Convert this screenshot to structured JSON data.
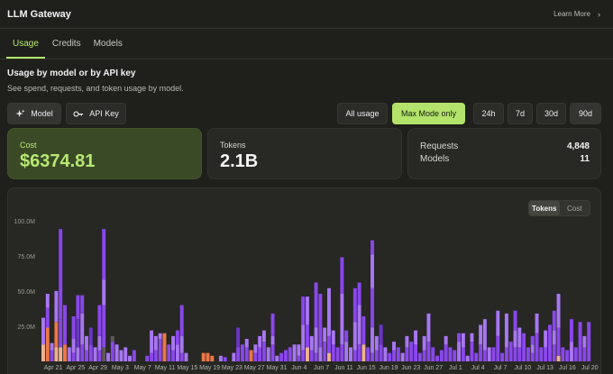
{
  "header": {
    "title": "LLM Gateway",
    "learn_more": "Learn More",
    "chevron": "›"
  },
  "tabs": [
    {
      "label": "Usage",
      "active": true
    },
    {
      "label": "Credits"
    },
    {
      "label": "Models"
    }
  ],
  "section": {
    "title": "Usage by model or by API key",
    "subtitle": "See spend, requests, and token usage by model."
  },
  "group_by": {
    "model": "Model",
    "api_key": "API Key",
    "selected": "Model"
  },
  "filters": {
    "all_usage": "All usage",
    "max_mode": "Max Mode only",
    "selected": "Max Mode only"
  },
  "ranges": {
    "items": [
      "24h",
      "7d",
      "30d",
      "90d"
    ],
    "selected": "90d"
  },
  "stats": {
    "cost_label": "Cost",
    "cost_value": "$6374.81",
    "tokens_label": "Tokens",
    "tokens_value": "2.1B",
    "requests_label": "Requests",
    "requests_value": "4,848",
    "models_label": "Models",
    "models_value": "11"
  },
  "chart_toggle": {
    "tokens": "Tokens",
    "cost": "Cost",
    "selected": "Tokens"
  },
  "colors": {
    "accent": "#b6e86c",
    "series": [
      "#8a47ec",
      "#a877f2",
      "#6a35c8",
      "#ee7746",
      "#f1b28f",
      "#5c5a55"
    ]
  },
  "chart_data": {
    "type": "bar",
    "stacked": true,
    "ylim": [
      0,
      105
    ],
    "yticks": [
      "100.0M",
      "75.0M",
      "50.0M",
      "25.0M"
    ],
    "ytick_values": [
      100,
      75,
      50,
      25
    ],
    "xtick_labels": [
      "Apr 21",
      "Apr 25",
      "Apr 29",
      "May 3",
      "May 7",
      "May 11",
      "May 15",
      "May 19",
      "May 23",
      "May 27",
      "May 31",
      "Jun 4",
      "Jun 7",
      "Jun 11",
      "Jun 15",
      "Jun 19",
      "Jun 23",
      "Jun 27",
      "Jul 1",
      "Jul 4",
      "Jul 7",
      "Jul 10",
      "Jul 13",
      "Jul 16",
      "Jul 20"
    ],
    "days": [
      [
        [
          12,
          4
        ],
        [
          19,
          1
        ]
      ],
      [
        [
          24,
          3
        ],
        [
          14,
          0
        ],
        [
          10,
          1
        ]
      ],
      [
        [
          8,
          0
        ],
        [
          5,
          1
        ]
      ],
      [
        [
          10,
          4
        ],
        [
          18,
          3
        ],
        [
          22,
          1
        ]
      ],
      [
        [
          10,
          4
        ],
        [
          20,
          0
        ],
        [
          64,
          0
        ]
      ],
      [
        [
          12,
          3
        ],
        [
          28,
          0
        ]
      ],
      [
        [
          10,
          1
        ]
      ],
      [
        [
          6,
          0
        ],
        [
          10,
          1
        ],
        [
          16,
          0
        ]
      ],
      [
        [
          10,
          1
        ],
        [
          20,
          2
        ],
        [
          17,
          0
        ]
      ],
      [
        [
          12,
          0
        ],
        [
          22,
          1
        ],
        [
          13,
          0
        ]
      ],
      [
        [
          8,
          0
        ],
        [
          10,
          1
        ]
      ],
      [
        [
          12,
          0
        ],
        [
          12,
          2
        ]
      ],
      [
        [
          10,
          1
        ]
      ],
      [
        [
          8,
          0
        ],
        [
          10,
          1
        ],
        [
          22,
          0
        ]
      ],
      [
        [
          10,
          5
        ],
        [
          30,
          0
        ],
        [
          18,
          1
        ],
        [
          36,
          0
        ]
      ],
      [
        [
          6,
          1
        ]
      ],
      [
        [
          14,
          0
        ],
        [
          4,
          5
        ]
      ],
      [
        [
          12,
          1
        ]
      ],
      [
        [
          8,
          1
        ]
      ],
      [
        [
          10,
          1
        ]
      ],
      [
        [
          4,
          1
        ]
      ],
      [
        [
          8,
          0
        ]
      ],
      [],
      [],
      [
        [
          4,
          0
        ]
      ],
      [
        [
          6,
          0
        ],
        [
          16,
          1
        ]
      ],
      [
        [
          8,
          0
        ],
        [
          10,
          1
        ]
      ],
      [
        [
          16,
          0
        ],
        [
          4,
          1
        ]
      ],
      [
        [
          20,
          3
        ]
      ],
      [
        [
          12,
          0
        ]
      ],
      [
        [
          8,
          0
        ],
        [
          10,
          1
        ]
      ],
      [
        [
          12,
          1
        ],
        [
          10,
          0
        ]
      ],
      [
        [
          6,
          0
        ],
        [
          12,
          1
        ],
        [
          22,
          0
        ]
      ],
      [
        [
          6,
          1
        ]
      ],
      [],
      [],
      [],
      [
        [
          6,
          3
        ]
      ],
      [
        [
          6,
          3
        ]
      ],
      [
        [
          4,
          3
        ]
      ],
      [],
      [
        [
          4,
          1
        ]
      ],
      [
        [
          3,
          0
        ]
      ],
      [],
      [
        [
          6,
          1
        ]
      ],
      [
        [
          10,
          0
        ],
        [
          14,
          2
        ]
      ],
      [
        [
          12,
          0
        ]
      ],
      [
        [
          10,
          0
        ],
        [
          6,
          1
        ]
      ],
      [
        [
          8,
          3
        ]
      ],
      [
        [
          6,
          0
        ],
        [
          6,
          1
        ]
      ],
      [
        [
          10,
          0
        ],
        [
          8,
          1
        ]
      ],
      [
        [
          14,
          0
        ],
        [
          8,
          1
        ]
      ],
      [
        [
          10,
          1
        ]
      ],
      [
        [
          12,
          0
        ],
        [
          6,
          1
        ],
        [
          16,
          0
        ]
      ],
      [
        [
          4,
          1
        ]
      ],
      [
        [
          6,
          0
        ]
      ],
      [
        [
          8,
          0
        ]
      ],
      [
        [
          10,
          0
        ]
      ],
      [
        [
          12,
          1
        ]
      ],
      [
        [
          4,
          0
        ],
        [
          8,
          1
        ]
      ],
      [
        [
          8,
          0
        ],
        [
          18,
          1
        ],
        [
          20,
          0
        ]
      ],
      [
        [
          10,
          4
        ],
        [
          16,
          0
        ],
        [
          20,
          1
        ]
      ],
      [
        [
          8,
          0
        ],
        [
          10,
          1
        ]
      ],
      [
        [
          6,
          0
        ],
        [
          18,
          1
        ],
        [
          32,
          0
        ]
      ],
      [
        [
          10,
          1
        ],
        [
          38,
          0
        ]
      ],
      [
        [
          14,
          0
        ],
        [
          10,
          1
        ]
      ],
      [
        [
          6,
          4
        ],
        [
          12,
          0
        ],
        [
          34,
          1
        ]
      ],
      [
        [
          12,
          0
        ],
        [
          10,
          1
        ]
      ],
      [
        [
          10,
          0
        ]
      ],
      [
        [
          12,
          0
        ],
        [
          36,
          1
        ],
        [
          26,
          0
        ]
      ],
      [
        [
          14,
          1
        ],
        [
          8,
          0
        ]
      ],
      [
        [
          10,
          1
        ]
      ],
      [
        [
          8,
          0
        ],
        [
          20,
          1
        ],
        [
          24,
          0
        ]
      ],
      [
        [
          12,
          0
        ],
        [
          28,
          1
        ],
        [
          16,
          0
        ]
      ],
      [
        [
          12,
          4
        ],
        [
          20,
          0
        ]
      ],
      [
        [
          10,
          0
        ]
      ],
      [
        [
          6,
          0
        ],
        [
          18,
          1
        ],
        [
          28,
          0
        ],
        [
          24,
          1
        ],
        [
          10,
          0
        ]
      ],
      [
        [
          8,
          0
        ],
        [
          10,
          1
        ]
      ],
      [
        [
          12,
          0
        ],
        [
          14,
          2
        ]
      ],
      [
        [
          10,
          1
        ]
      ],
      [
        [
          6,
          0
        ]
      ],
      [
        [
          8,
          0
        ],
        [
          6,
          1
        ]
      ],
      [
        [
          10,
          0
        ]
      ],
      [
        [
          6,
          1
        ]
      ],
      [
        [
          10,
          0
        ],
        [
          8,
          1
        ]
      ],
      [
        [
          14,
          0
        ]
      ],
      [
        [
          12,
          0
        ],
        [
          10,
          1
        ]
      ],
      [
        [
          6,
          0
        ]
      ],
      [
        [
          8,
          0
        ],
        [
          10,
          1
        ]
      ],
      [
        [
          14,
          0
        ],
        [
          20,
          1
        ]
      ],
      [
        [
          10,
          0
        ]
      ],
      [
        [
          4,
          0
        ]
      ],
      [
        [
          8,
          0
        ]
      ],
      [
        [
          12,
          0
        ],
        [
          6,
          1
        ]
      ],
      [
        [
          10,
          0
        ]
      ],
      [
        [
          8,
          0
        ]
      ],
      [
        [
          14,
          1
        ],
        [
          6,
          0
        ]
      ],
      [
        [
          10,
          0
        ],
        [
          10,
          1
        ]
      ],
      [
        [
          4,
          1
        ]
      ],
      [
        [
          14,
          0
        ],
        [
          6,
          1
        ]
      ],
      [
        [
          6,
          0
        ]
      ],
      [
        [
          12,
          0
        ],
        [
          14,
          1
        ]
      ],
      [
        [
          8,
          0
        ],
        [
          22,
          1
        ]
      ],
      [
        [
          10,
          1
        ]
      ],
      [
        [
          10,
          0
        ]
      ],
      [
        [
          18,
          0
        ],
        [
          18,
          1
        ]
      ],
      [
        [
          6,
          0
        ]
      ],
      [
        [
          10,
          0
        ],
        [
          24,
          1
        ]
      ],
      [
        [
          14,
          0
        ]
      ],
      [
        [
          10,
          0
        ],
        [
          12,
          1
        ],
        [
          14,
          0
        ]
      ],
      [
        [
          10,
          0
        ],
        [
          14,
          1
        ]
      ],
      [
        [
          20,
          0
        ]
      ],
      [
        [
          10,
          0
        ]
      ],
      [
        [
          6,
          0
        ],
        [
          6,
          1
        ],
        [
          6,
          0
        ]
      ],
      [
        [
          20,
          0
        ],
        [
          14,
          1
        ]
      ],
      [
        [
          10,
          0
        ]
      ],
      [
        [
          10,
          0
        ],
        [
          12,
          1
        ]
      ],
      [
        [
          26,
          0
        ]
      ],
      [
        [
          12,
          0
        ],
        [
          10,
          1
        ],
        [
          14,
          0
        ]
      ],
      [
        [
          4,
          4
        ],
        [
          20,
          0
        ],
        [
          24,
          1
        ]
      ],
      [
        [
          10,
          0
        ]
      ],
      [
        [
          8,
          0
        ]
      ],
      [
        [
          14,
          1
        ],
        [
          16,
          0
        ]
      ],
      [
        [
          10,
          0
        ]
      ],
      [
        [
          28,
          0
        ]
      ],
      [
        [
          10,
          0
        ],
        [
          8,
          1
        ]
      ],
      [
        [
          28,
          0
        ]
      ]
    ]
  }
}
